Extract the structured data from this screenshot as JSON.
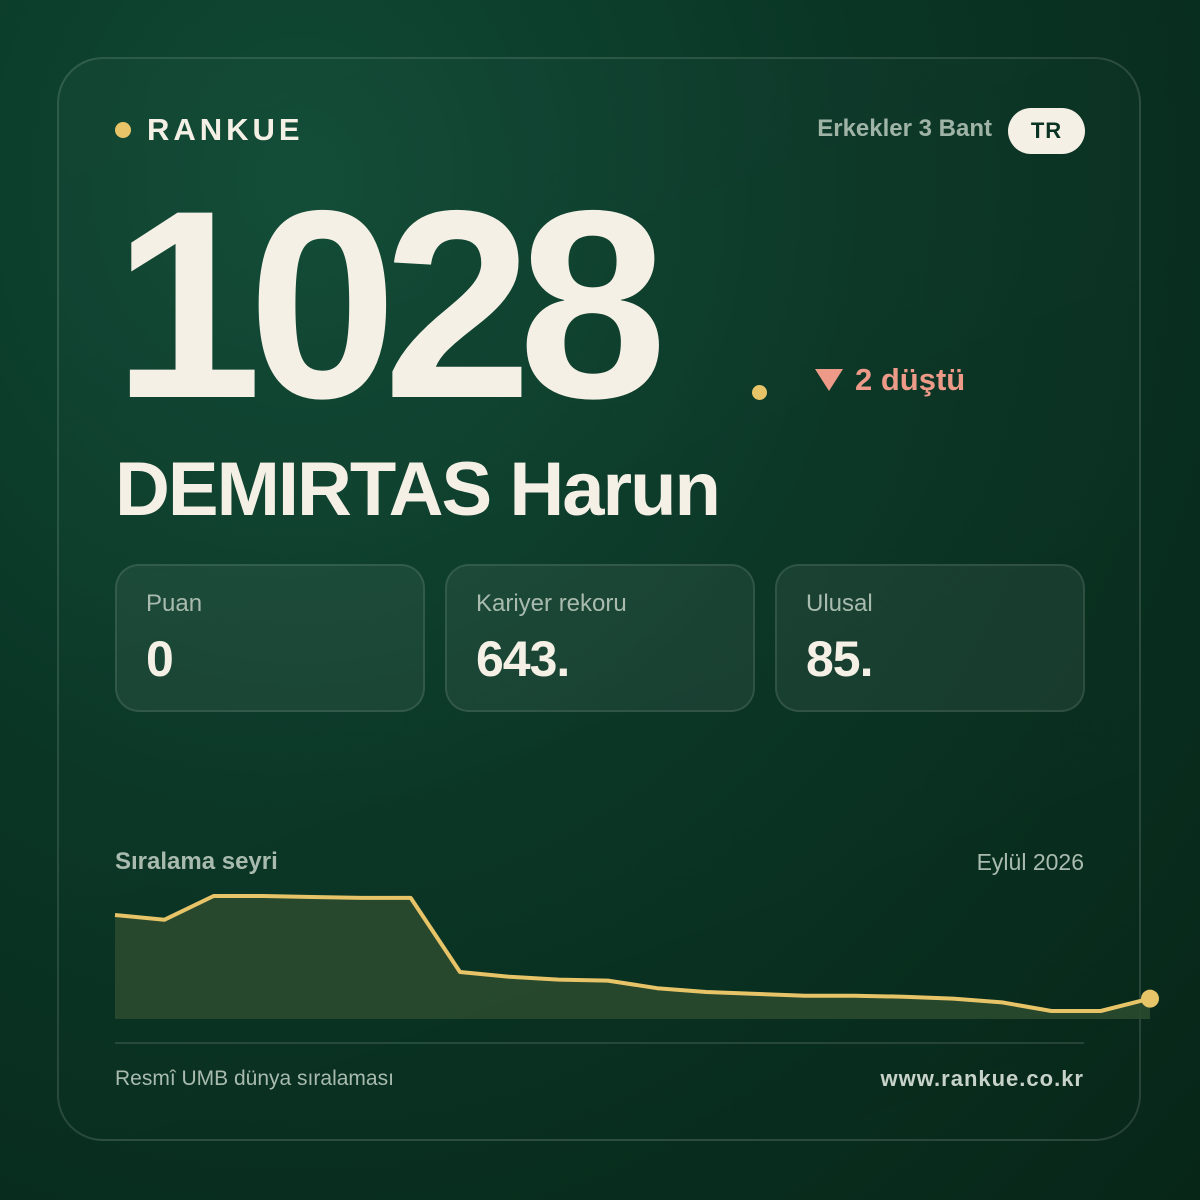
{
  "brand": {
    "name": "RANKUE",
    "accent_color": "#e8c468"
  },
  "header": {
    "category": "Erkekler 3 Bant",
    "country_code": "TR"
  },
  "rank": {
    "value": "1028",
    "change_text": "2 düştü",
    "change_direction": "down",
    "change_color": "#ee9a88",
    "change_icon": "triangle-down-icon"
  },
  "player": {
    "name": "DEMIRTAS Harun"
  },
  "stats": [
    {
      "label": "Puan",
      "value": "0"
    },
    {
      "label": "Kariyer rekoru",
      "value": "643."
    },
    {
      "label": "Ulusal",
      "value": "85."
    }
  ],
  "trend": {
    "title": "Sıralama seyri",
    "date_label": "Eylül 2026"
  },
  "chart_data": {
    "type": "area",
    "y_inverted": true,
    "values": [
      940,
      945,
      920,
      920,
      921,
      922,
      922,
      1000,
      1005,
      1008,
      1009,
      1017,
      1021,
      1023,
      1025,
      1025,
      1026,
      1028,
      1032,
      1041,
      1041,
      1028
    ],
    "line_color": "#e8c468",
    "fill_color": "#2a4a2e"
  },
  "footer": {
    "source": "Resmî UMB dünya sıralaması",
    "url": "www.rankue.co.kr"
  }
}
